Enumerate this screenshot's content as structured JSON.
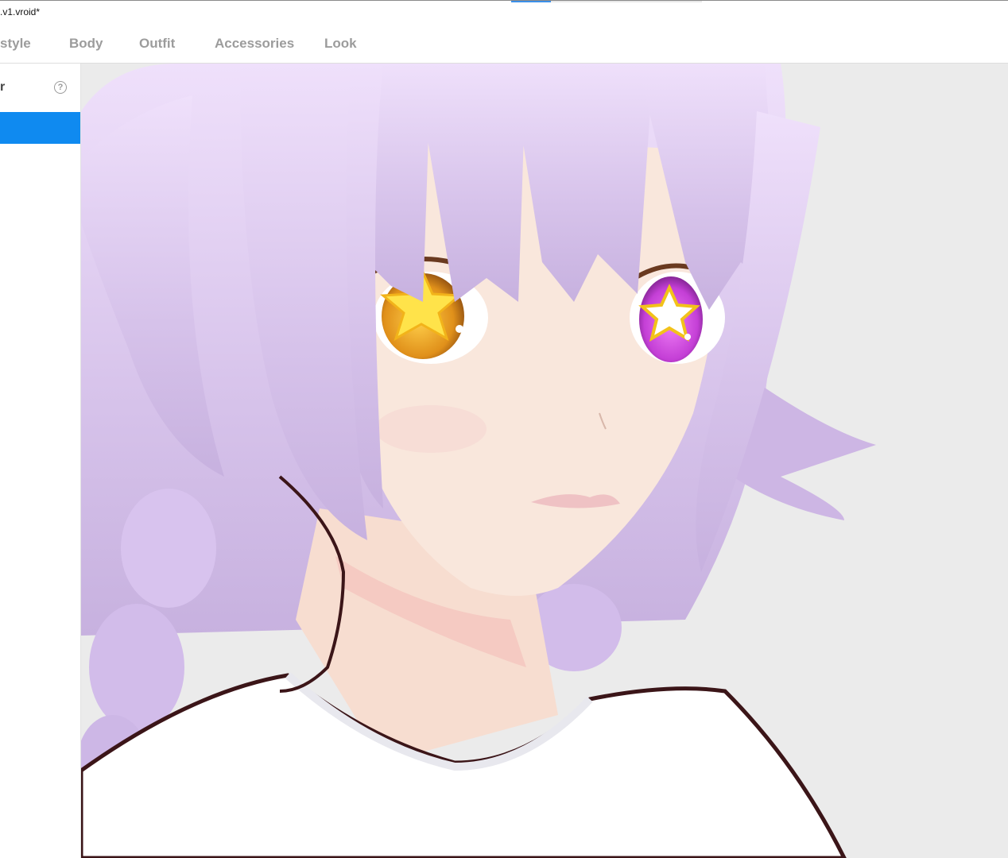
{
  "window": {
    "title": ".v1.vroid*"
  },
  "tabs": [
    {
      "label": "style"
    },
    {
      "label": "Body"
    },
    {
      "label": "Outfit"
    },
    {
      "label": "Accessories"
    },
    {
      "label": "Look"
    }
  ],
  "sidebar": {
    "header": "r",
    "help_icon": "question-circle-icon"
  },
  "viewport": {
    "character": {
      "hair_color": "#d9c6ee",
      "left_eye_color": "#e89a1c",
      "right_eye_color": "#c43fd6",
      "skin_color": "#f8e4d8",
      "shirt_color": "#ffffff"
    }
  },
  "colors": {
    "accent": "#0f8af0",
    "tab_text": "#9c9c9c",
    "viewport_bg": "#ebebeb"
  }
}
